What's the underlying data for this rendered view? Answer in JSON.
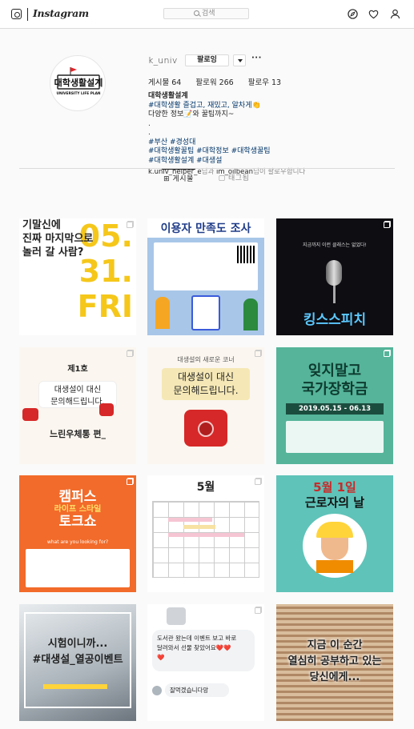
{
  "header": {
    "logo_text": "Instagram",
    "search_placeholder": "검색"
  },
  "profile": {
    "avatar_text": "대학생활설계",
    "avatar_subtext": "UNIVERSITY LIFE PLAN",
    "username": "k_univ",
    "follow_label": "팔로잉",
    "stats": {
      "posts": "게시물 64",
      "followers": "팔로워 266",
      "following": "팔로우 13"
    },
    "bio_name": "대학생활설계",
    "bio_lines": [
      "#대학생활 즐겁고, 재밌고, 알차게👏",
      "다양한 정보📝와 꿀팁까지~",
      ".",
      ".",
      "#부산 #경성대",
      "#대학생활꿀팁 #대학정보 #대학생꿀팁",
      "#대학생활설계 #대생설"
    ],
    "followed_by_user1": "k.univ_helper_e",
    "followed_by_mid": "님과 ",
    "followed_by_user2": "im_oilbean",
    "followed_by_end": "님이 팔로우합니다"
  },
  "tabs": {
    "posts": "게시물",
    "tagged": "태그됨"
  },
  "posts": [
    {
      "lines": [
        "기말신에",
        "진짜 마지막으로",
        "놀러 갈 사람?"
      ],
      "big": "05. 31. FRI"
    },
    {
      "lines": [
        "이용자 만족도 조사"
      ]
    },
    {
      "lines": [
        "킹스스피치"
      ],
      "sub": "지금까지 이런 클래스는 없었다!"
    },
    {
      "lines": [
        "제1호",
        "대생설이 대신",
        "문의해드립니다.",
        "느린우체통 편_"
      ]
    },
    {
      "lines": [
        "대생설의 새로운 코너",
        "대생설이 대신",
        "문의해드립니다."
      ]
    },
    {
      "lines": [
        "잊지말고",
        "국가장학금"
      ],
      "sub": "2019.05.15 - 06.13"
    },
    {
      "lines": [
        "캠퍼스",
        "라이프 스타일",
        "토크쇼"
      ],
      "sub": "what are you looking for?"
    },
    {
      "lines": [
        "5월"
      ]
    },
    {
      "lines": [
        "5월 1일",
        "근로자의 날"
      ]
    },
    {
      "lines": [
        "시험이니까...",
        "#대생설_열공이벤트"
      ]
    },
    {
      "lines": [
        "도서관 왔는데 이벤트 보고 바로",
        "달려와서 선물 찾았어요❤️❤️",
        "❤️",
        "잘먹겠습니다앙"
      ]
    },
    {
      "lines": [
        "지금 이 순간",
        "열심히 공부하고 있는",
        "당신에게..."
      ]
    }
  ],
  "colors": {
    "accent_link": "#003569",
    "poster_yellow": "#f5c71a",
    "poster_teal": "#55b49a",
    "poster_orange": "#f26b2a"
  }
}
